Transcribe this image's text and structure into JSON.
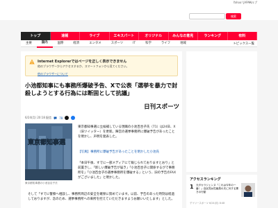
{
  "top": {
    "links": [
      "Yahoo! JAPAN",
      "ヘルプ"
    ]
  },
  "header": {
    "search_placeholder": "",
    "search_button": "検索"
  },
  "nav": {
    "tabs": [
      "トップ",
      "速報",
      "ライブ",
      "エキスパート",
      "オリジナル",
      "みんなの意見",
      "ランキング",
      "有料"
    ],
    "active": 0
  },
  "subnav": {
    "items": [
      "主要",
      "国内",
      "国際",
      "経済",
      "エンタメ",
      "スポーツ",
      "IT",
      "科学",
      "ライフ",
      "地域"
    ],
    "active": 1,
    "right": "トピックス一覧"
  },
  "notice": {
    "title": "Internet Explorerではページを正しく表示できません",
    "text": "他のブラウザーからアクセスするか、スマートフォンから見てください。",
    "link": "他のブラウザーについて"
  },
  "article": {
    "headline": "小池都知事にも事務所爆破予告、Xで公表「選挙を暴力で封殺しようとする行為には断固として抗議」",
    "source": "日刊スポーツ",
    "dateline": "6/24(月) 20:18 配信",
    "comments": "78",
    "photo_text": "東京都知事選",
    "caption": "東京都知事選の小池百合子氏",
    "p1": "東京都知事選に立候補している現職の小池百合子氏（71）は24日、X（旧ツイッター）を更新。陣営の選挙事務所に爆破予告があったことを明かし、声明を発表した。",
    "p2": "【写真】事務所に爆破予告があったことを明かした小池氏",
    "p3": "「本日午後、すでに一部メディアにて報じられておりますとおり」と前置きし、「新しい爆破予告が届き」「小池百合子に関係するがで事務所を」「小池百合子の選挙事務所を爆破する」という、旧の予告のFAXがございました」と明かした。",
    "p4": "そして「すでに警察へ相談し、事務所周辺の安全を確保に努めています。以前、予告のあった時刻は経過しておりますが、念のため、選挙事務所への来所を控えていただきますようお願いいたします」とした。"
  },
  "ranking": {
    "title": "アクセスランキング",
    "num": "1",
    "text": "元タカラジェンヌ「これは今年の一番！」自民党女性議員の夫に対する驚きの行動",
    "source": "デイリースポーツ 6/24(月) 8:48"
  },
  "colors": {
    "accent": "#ff0033",
    "link": "#1a5fb4"
  }
}
